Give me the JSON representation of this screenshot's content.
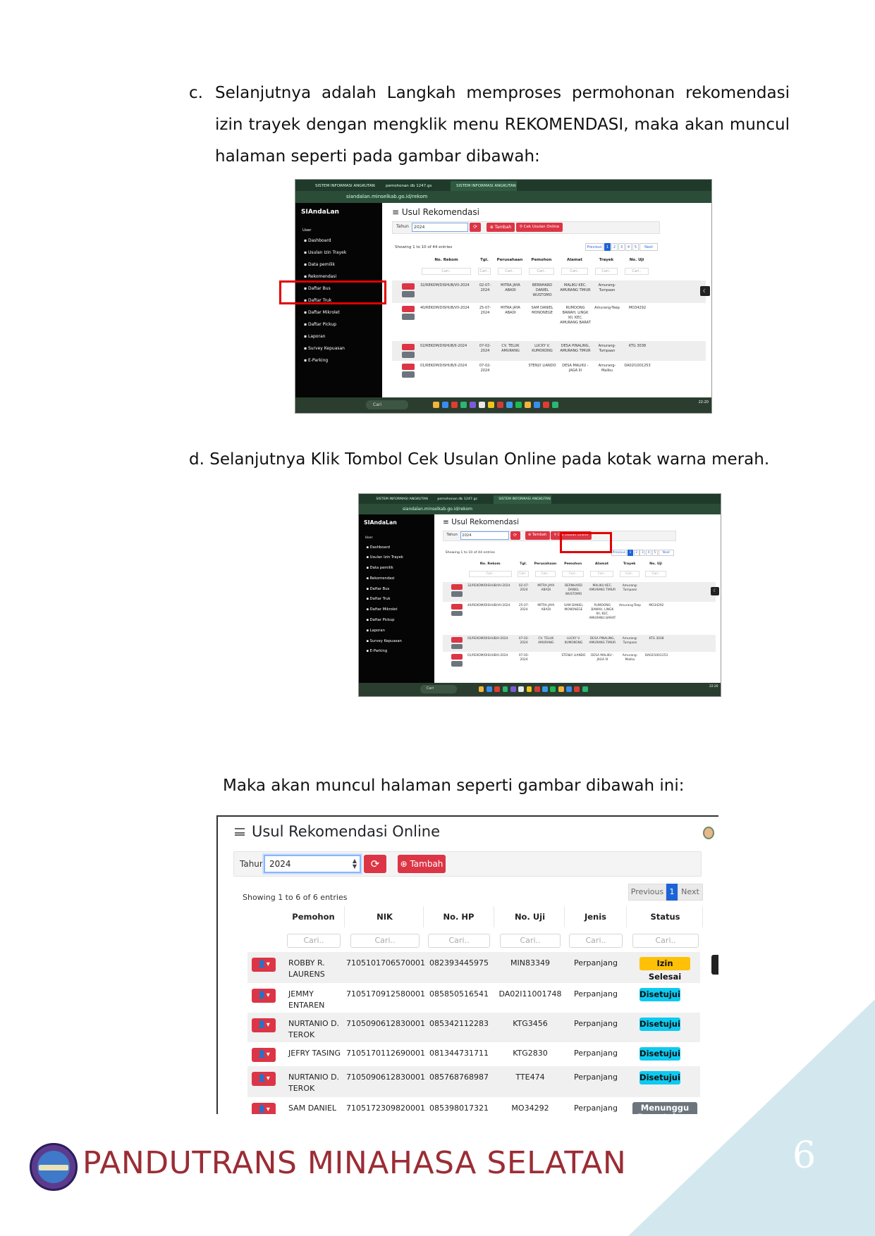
{
  "section_c": {
    "marker": "c.",
    "text": "Selanjutnya adalah Langkah memproses permohonan rekomendasi izin trayek dengan mengklik menu REKOMENDASI, maka  akan muncul halaman seperti pada gambar dibawah:"
  },
  "section_d": {
    "text": "d. Selanjutnya Klik Tombol Cek Usulan Online pada kotak warna merah."
  },
  "section_m": {
    "text": "Maka akan muncul halaman seperti gambar dibawah ini:"
  },
  "small_screens": {
    "tabs": [
      "SISTEM INFORMASI ANGKUTAN",
      "pemohonan db 1247.gs",
      "SISTEM INFORMASI ANGKUTAN"
    ],
    "address": "siandalan.minselkab.go.id/rekom",
    "brand": "SIAndaLan",
    "sidebar_section": "User",
    "sidebar_items": [
      "Dashboard",
      "Usulan Izin Trayek",
      "Data pemilik",
      "Rekomendasi",
      "Daftar Bus",
      "Daftar Truk",
      "Daftar Mikrolet",
      "Daftar Pickup",
      "Laporan",
      "Survey Kepuasan",
      "E-Parking"
    ],
    "page_title": "Usul Rekomendasi",
    "filter_label": "Tahun",
    "year": "2024",
    "add_label": "Tambah",
    "cek_label": "Cek Usulan Online",
    "info": "Showing 1 to 10 of 44 entries",
    "pager": [
      "Previous",
      "1",
      "2",
      "3",
      "4",
      "5",
      "Next"
    ],
    "columns": [
      "No. Rekom",
      "Tgl.",
      "Perusahaan",
      "Pemohon",
      "Alamat",
      "Trayek",
      "No. Uji"
    ],
    "search_placeholder": "Cari..",
    "rows": [
      [
        "32/REKOM/DISHUB/VII-2024",
        "02-07-2024",
        "MITRA JAYA ABADI",
        "BERNHARD DANIEL WUSTOMO",
        "MALIKU KEC. AMURANG TIMUR",
        "Amurang-Tumpaan",
        ""
      ],
      [
        "40/REKOM/DISHUB/VII-2024",
        "25-07-2024",
        "MITRA JAYA ABADI",
        "SAM DANIEL MONONEGE",
        "RUMOONG BAWAH, LINGK XII, KEC. AMURANG BARAT",
        "Amurang-Teep",
        "MO34292"
      ],
      [
        "02/REKOM/DISHUB/II-2024",
        "07-02-2024",
        "CV. TELUK AMURANG",
        "LUCKY V. KUMOKONG",
        "DESA PINALING, AMURANG TIMUR",
        "Amurang-Tumpaan",
        "KTG 3038"
      ],
      [
        "01/REKOM/DISHUB/II-2024",
        "07-02-2024",
        "",
        "STENLY LIANDO",
        "DESA MALIKU - JAGA III",
        "Amurang-Maliku",
        "DA02I1001253"
      ]
    ],
    "taskbar_search": "Cari",
    "clock": "22:20"
  },
  "big_screen": {
    "title": "Usul Rekomendasi Online",
    "filter_label": "Tahun",
    "year": "2024",
    "refresh_icon": "refresh-icon",
    "add_label": "Tambah",
    "info": "Showing 1 to 6 of 6 entries",
    "pager": {
      "prev": "Previous",
      "current": "1",
      "next": "Next"
    },
    "columns": [
      "Pemohon",
      "NIK",
      "No. HP",
      "No. Uji",
      "Jenis",
      "Status"
    ],
    "search_placeholder": "Cari..",
    "rows": [
      {
        "pemohon": "ROBBY R. LAURENS",
        "nik": "7105101706570001",
        "hp": "082393445975",
        "uji": "MIN83349",
        "jenis": "Perpanjang",
        "status": "Izin Selesai",
        "status_color": "#ffc107"
      },
      {
        "pemohon": "JEMMY ENTAREN",
        "nik": "7105170912580001",
        "hp": "085850516541",
        "uji": "DA02I11001748",
        "jenis": "Perpanjang",
        "status": "Disetujui",
        "status_color": "#0dcaf0"
      },
      {
        "pemohon": "NURTANIO D. TEROK",
        "nik": "7105090612830001",
        "hp": "085342112283",
        "uji": "KTG3456",
        "jenis": "Perpanjang",
        "status": "Disetujui",
        "status_color": "#0dcaf0"
      },
      {
        "pemohon": "JEFRY TASING",
        "nik": "7105170112690001",
        "hp": "081344731711",
        "uji": "KTG2830",
        "jenis": "Perpanjang",
        "status": "Disetujui",
        "status_color": "#0dcaf0"
      },
      {
        "pemohon": "NURTANIO D. TEROK",
        "nik": "7105090612830001",
        "hp": "085768768987",
        "uji": "TTE474",
        "jenis": "Perpanjang",
        "status": "Disetujui",
        "status_color": "#0dcaf0"
      },
      {
        "pemohon": "SAM DANIEL MONONEGE",
        "nik": "7105172309820001",
        "hp": "085398017321",
        "uji": "MO34292",
        "jenis": "Perpanjang",
        "status": "Menunggu Persetujuan",
        "status_color": "#6c757d"
      }
    ]
  },
  "footer": {
    "title": "PANDUTRANS MINAHASA SELATAN",
    "page_number": "6",
    "accent_color": "#9b2d35",
    "triangle_color": "#d3e8ee"
  }
}
